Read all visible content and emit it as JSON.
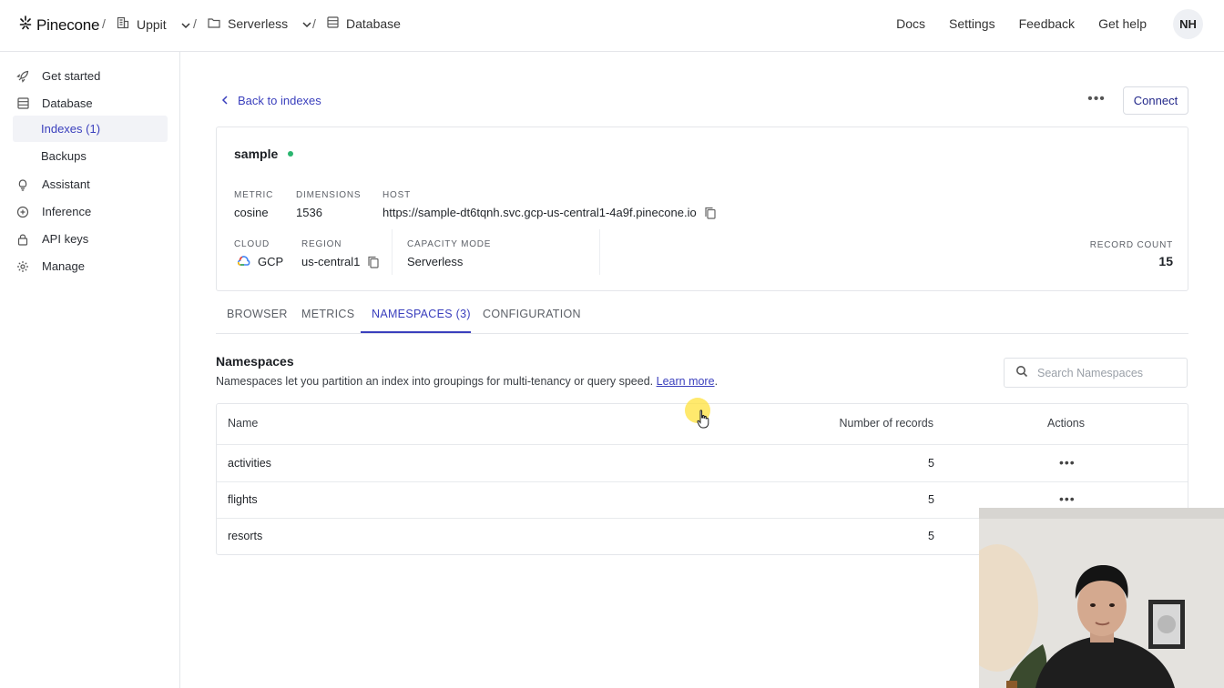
{
  "header": {
    "brand": "Pinecone",
    "breadcrumbs": [
      {
        "label": "Uppit",
        "icon": "building-icon",
        "dropdown": true
      },
      {
        "label": "Serverless",
        "icon": "folder-icon",
        "dropdown": true
      },
      {
        "label": "Database",
        "icon": "database-icon",
        "dropdown": false
      }
    ],
    "links": [
      "Docs",
      "Settings",
      "Feedback",
      "Get help"
    ],
    "avatar_initials": "NH"
  },
  "sidebar": {
    "items": [
      {
        "label": "Get started",
        "icon": "rocket-icon"
      },
      {
        "label": "Database",
        "icon": "database-icon"
      },
      {
        "label": "Indexes (1)",
        "sub": true,
        "active": true
      },
      {
        "label": "Backups",
        "sub": true
      },
      {
        "label": "Assistant",
        "icon": "lightbulb-icon"
      },
      {
        "label": "Inference",
        "icon": "inference-icon"
      },
      {
        "label": "API keys",
        "icon": "lock-icon"
      },
      {
        "label": "Manage",
        "icon": "gear-icon"
      }
    ]
  },
  "main": {
    "back_label": "Back to indexes",
    "connect_label": "Connect",
    "index": {
      "name": "sample",
      "status_color": "#2ab56f",
      "metric_label": "METRIC",
      "metric": "cosine",
      "dimensions_label": "DIMENSIONS",
      "dimensions": "1536",
      "host_label": "HOST",
      "host": "https://sample-dt6tqnh.svc.gcp-us-central1-4a9f.pinecone.io",
      "cloud_label": "CLOUD",
      "cloud": "GCP",
      "region_label": "REGION",
      "region": "us-central1",
      "capacity_label": "CAPACITY MODE",
      "capacity": "Serverless",
      "record_count_label": "RECORD COUNT",
      "record_count": "15"
    },
    "tabs": [
      {
        "label": "BROWSER"
      },
      {
        "label": "METRICS"
      },
      {
        "label": "NAMESPACES (3)",
        "active": true
      },
      {
        "label": "CONFIGURATION"
      }
    ],
    "namespaces": {
      "title": "Namespaces",
      "description": "Namespaces let you partition an index into groupings for multi-tenancy or query speed.",
      "learn_more": "Learn more",
      "search_placeholder": "Search Namespaces",
      "columns": {
        "name": "Name",
        "records": "Number of records",
        "actions": "Actions"
      },
      "rows": [
        {
          "name": "activities",
          "records": "5"
        },
        {
          "name": "flights",
          "records": "5"
        },
        {
          "name": "resorts",
          "records": "5"
        }
      ]
    }
  },
  "colors": {
    "accent": "#3a3fbd",
    "status_green": "#2ab56f"
  }
}
